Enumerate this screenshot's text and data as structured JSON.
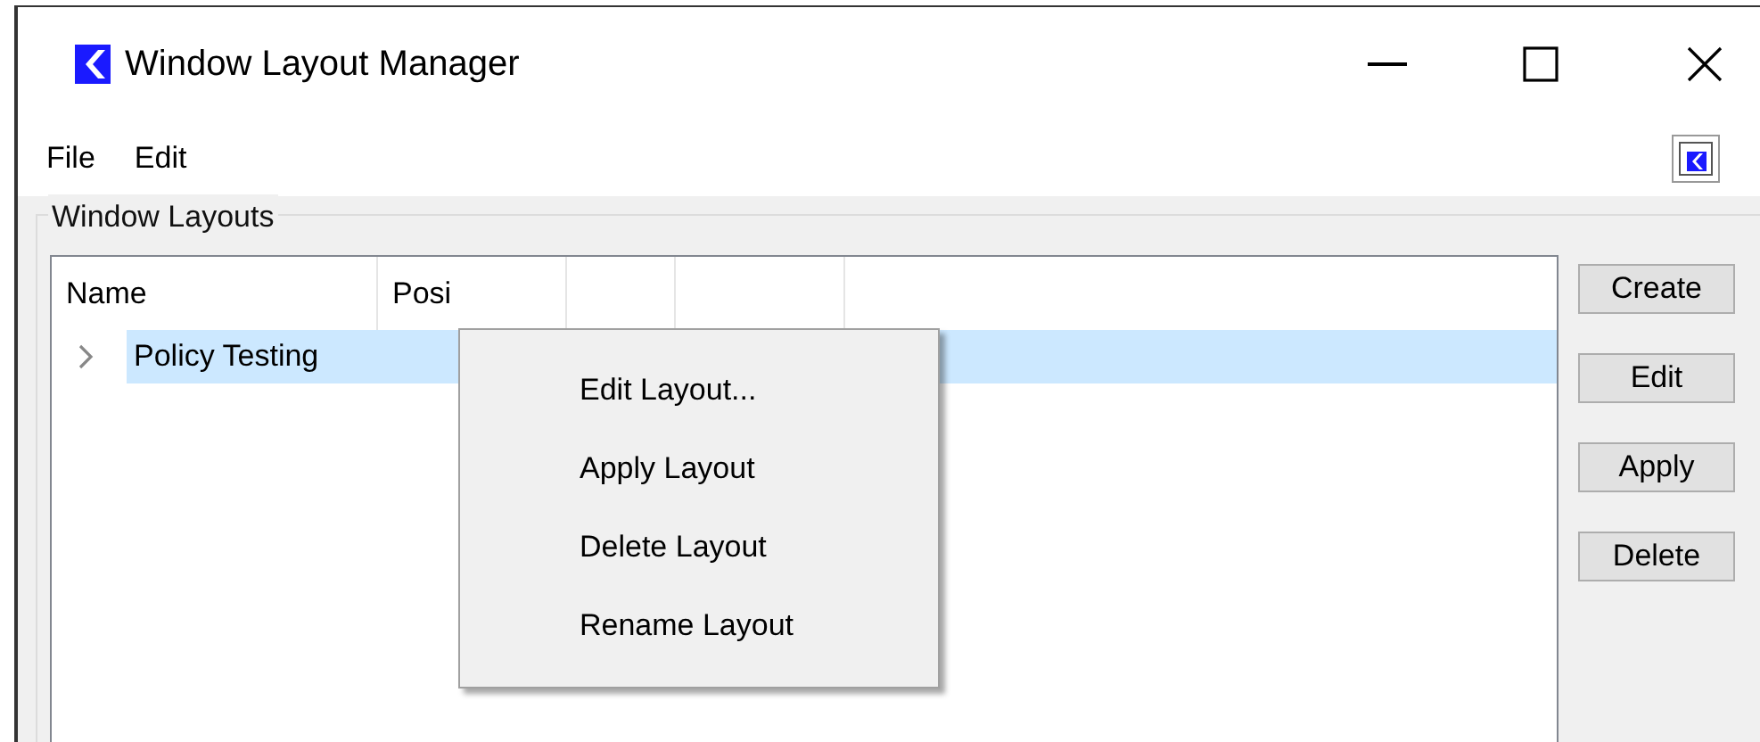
{
  "window": {
    "title": "Window Layout Manager"
  },
  "menu_bar": [
    "File",
    "Edit"
  ],
  "group": {
    "title": "Window Layouts"
  },
  "table": {
    "columns": [
      "Name",
      "Posi"
    ],
    "rows": [
      {
        "name": "Policy Testing",
        "expanded": false,
        "selected": true
      }
    ]
  },
  "context_menu": [
    "Edit Layout...",
    "Apply Layout",
    "Delete Layout",
    "Rename Layout"
  ],
  "buttons": [
    "Create",
    "Edit",
    "Apply",
    "Delete"
  ]
}
